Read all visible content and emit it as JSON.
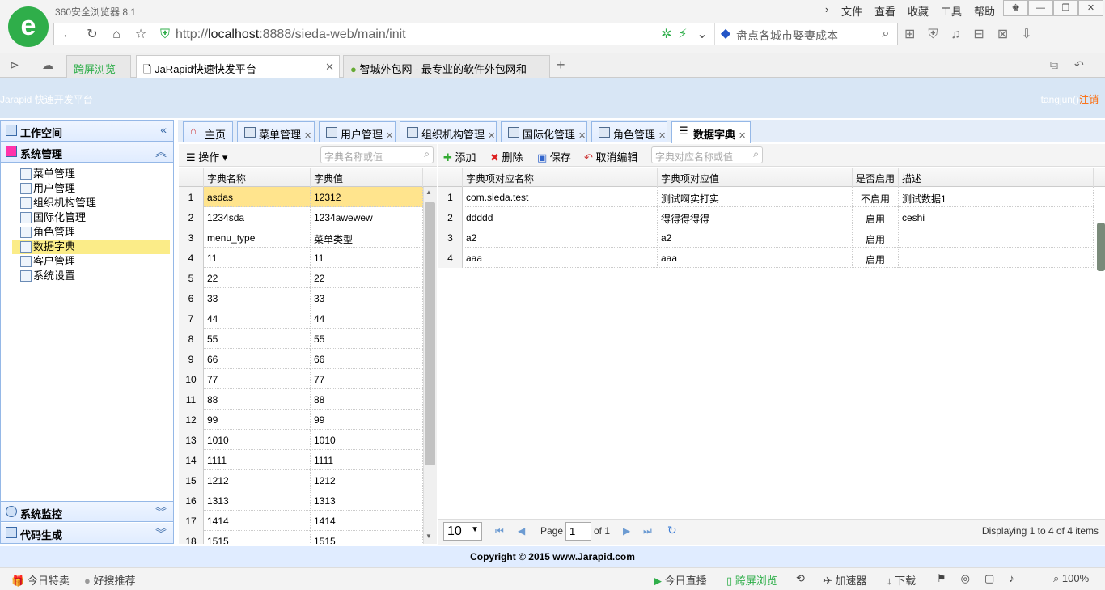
{
  "browser": {
    "title": "360安全浏览器 8.1",
    "menu": [
      "文件",
      "查看",
      "收藏",
      "工具",
      "帮助"
    ],
    "url_prefix": "http://",
    "url_host": "localhost",
    "url_rest": ":8888/sieda-web/main/init",
    "search_placeholder": "盘点各城市娶妻成本",
    "tabs": [
      {
        "label": "跨屏浏览"
      },
      {
        "label": "JaRapid快速快发平台"
      },
      {
        "label": "智城外包网 - 最专业的软件外包网和"
      }
    ],
    "status_left": [
      "今日特卖",
      "好搜推荐"
    ],
    "status_right": [
      "今日直播",
      "跨屏浏览",
      "加速器",
      "下载"
    ],
    "zoom": "100%"
  },
  "app": {
    "logo_text": "Jarapid 快速开发平台",
    "user": "tangjun()",
    "logout": "注销",
    "footer": "Copyright © 2015 www.Jarapid.com"
  },
  "sidebar": {
    "workspace": "工作空间",
    "system_mgmt": "系统管理",
    "items": [
      "菜单管理",
      "用户管理",
      "组织机构管理",
      "国际化管理",
      "角色管理",
      "数据字典",
      "客户管理",
      "系统设置"
    ],
    "monitor": "系统监控",
    "codegen": "代码生成"
  },
  "tabs": [
    {
      "label": "主页",
      "closable": false
    },
    {
      "label": "菜单管理",
      "closable": true
    },
    {
      "label": "用户管理",
      "closable": true
    },
    {
      "label": "组织机构管理",
      "closable": true
    },
    {
      "label": "国际化管理",
      "closable": true
    },
    {
      "label": "角色管理",
      "closable": true
    },
    {
      "label": "数据字典",
      "closable": true
    }
  ],
  "dict": {
    "op_label": "操作",
    "search_placeholder": "字典名称或值",
    "columns": [
      "字典名称",
      "字典值"
    ],
    "rows": [
      [
        "1",
        "asdas",
        "12312"
      ],
      [
        "2",
        "1234sda",
        "1234awewew"
      ],
      [
        "3",
        "menu_type",
        "菜单类型"
      ],
      [
        "4",
        "11",
        "11"
      ],
      [
        "5",
        "22",
        "22"
      ],
      [
        "6",
        "33",
        "33"
      ],
      [
        "7",
        "44",
        "44"
      ],
      [
        "8",
        "55",
        "55"
      ],
      [
        "9",
        "66",
        "66"
      ],
      [
        "10",
        "77",
        "77"
      ],
      [
        "11",
        "88",
        "88"
      ],
      [
        "12",
        "99",
        "99"
      ],
      [
        "13",
        "1010",
        "1010"
      ],
      [
        "14",
        "1111",
        "1111"
      ],
      [
        "15",
        "1212",
        "1212"
      ],
      [
        "16",
        "1313",
        "1313"
      ],
      [
        "17",
        "1414",
        "1414"
      ],
      [
        "18",
        "1515",
        "1515"
      ]
    ]
  },
  "items": {
    "toolbar": {
      "add": "添加",
      "delete": "删除",
      "save": "保存",
      "cancel": "取消编辑"
    },
    "search_placeholder": "字典对应名称或值",
    "columns": [
      "字典项对应名称",
      "字典项对应值",
      "是否启用",
      "描述"
    ],
    "rows": [
      [
        "1",
        "com.sieda.test",
        "测试啊实打实",
        "不启用",
        "测试数据1"
      ],
      [
        "2",
        "ddddd",
        "得得得得得",
        "启用",
        "ceshi"
      ],
      [
        "3",
        "a2",
        "a2",
        "启用",
        ""
      ],
      [
        "4",
        "aaa",
        "aaa",
        "启用",
        ""
      ]
    ],
    "pager": {
      "page_size": "10",
      "page_label": "Page",
      "page": "1",
      "of": "of 1",
      "display": "Displaying 1 to 4 of 4 items"
    }
  }
}
